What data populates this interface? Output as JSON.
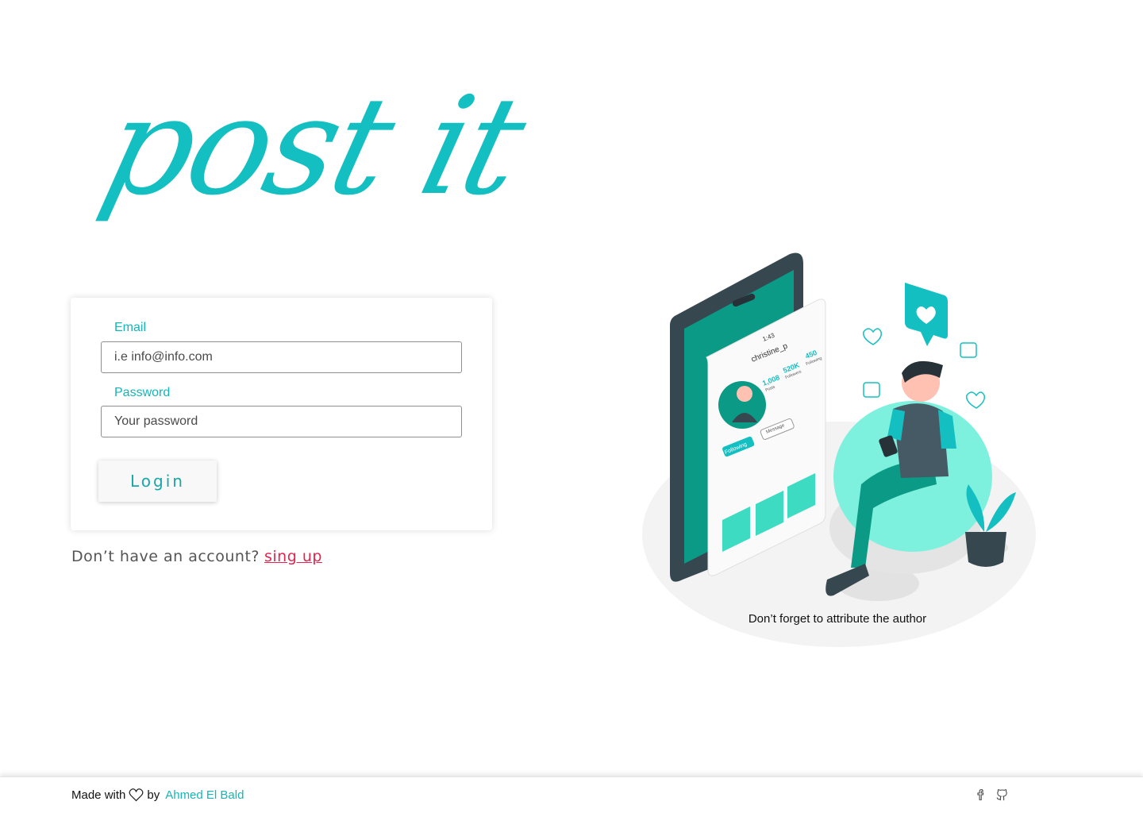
{
  "brand": {
    "logo_text": "post it",
    "accent_color": "#14bfc2"
  },
  "login_form": {
    "email_label": "Email",
    "email_placeholder": "i.e info@info.com",
    "password_label": "Password",
    "password_placeholder": "Your password",
    "login_button": "Login"
  },
  "signup": {
    "prompt": "Don’t have an account?",
    "link_text": "sing up",
    "link_color": "#e0264f"
  },
  "illustration": {
    "attribution": "Don’t forget to attribute the author",
    "phone": {
      "time": "1:43",
      "username": "christine_p",
      "posts_count": "1,008",
      "posts_label": "Posts",
      "followers_count": "520K",
      "followers_label": "Followers",
      "following_count": "450",
      "following_label": "Following",
      "following_button": "Following",
      "message_button": "Message"
    }
  },
  "footer": {
    "made_with": "Made with",
    "by": "by",
    "author": "Ahmed El Bald",
    "heart_icon": "heart-icon",
    "social_icons": [
      "facebook-icon",
      "github-icon"
    ]
  }
}
